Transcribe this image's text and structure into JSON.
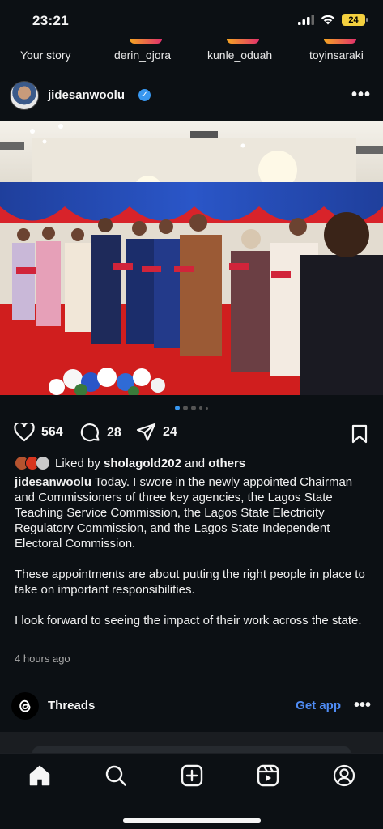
{
  "status": {
    "time": "23:21",
    "battery": "24"
  },
  "stories": [
    "Your story",
    "derin_ojora",
    "kunle_oduah",
    "toyinsaraki"
  ],
  "post": {
    "username": "jidesanwoolu",
    "likes": "564",
    "comments": "28",
    "shares": "24",
    "liked_by_prefix": "Liked by ",
    "liked_by_user": "sholagold202",
    "liked_by_mid": " and ",
    "liked_by_others": "others",
    "caption_user": "jidesanwoolu",
    "caption_p1": " Today. I swore in the newly appointed Chairman and Commissioners of three key agencies, the Lagos State Teaching Service Commission, the Lagos State Electricity Regulatory Commission, and the Lagos State Independent Electoral Commission.",
    "caption_p2": "These appointments are about putting the right people in place to take on important responsibilities.",
    "caption_p3": "I look forward to seeing the impact of their work across the state.",
    "time_ago": "4 hours ago"
  },
  "threads": {
    "label": "Threads",
    "cta": "Get app"
  },
  "icons": [
    "signal-icon",
    "wifi-icon",
    "battery-icon",
    "verified-icon",
    "more-icon",
    "heart-icon",
    "comment-icon",
    "share-icon",
    "bookmark-icon",
    "threads-icon",
    "home-icon",
    "search-icon",
    "create-icon",
    "reels-icon",
    "profile-icon"
  ],
  "colors": {
    "accent": "#4f8cf5",
    "verified": "#3897f0",
    "background": "#0c1014"
  }
}
